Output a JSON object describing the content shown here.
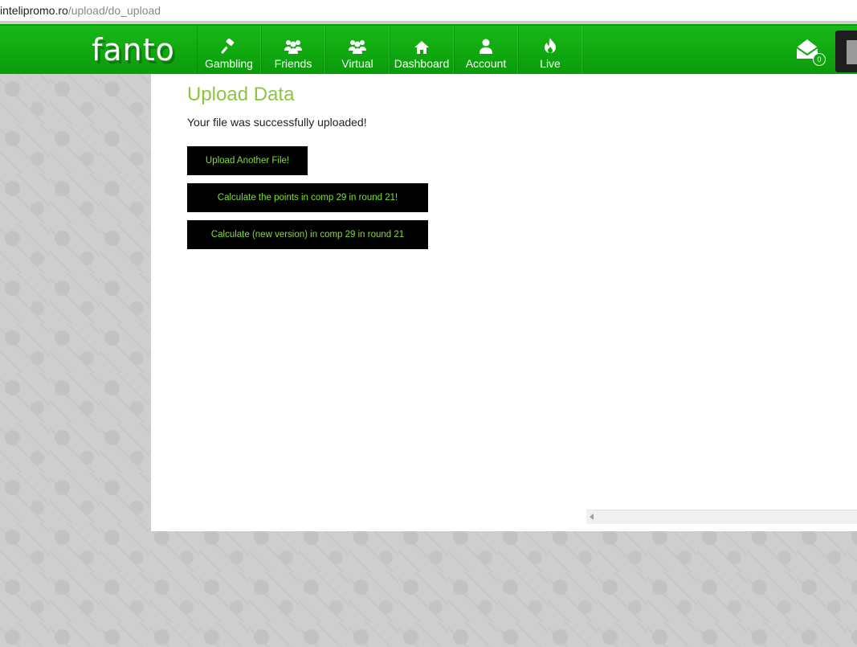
{
  "browser": {
    "url_domain": "intelipromo.ro",
    "url_path": "/upload/do_upload"
  },
  "header": {
    "logo": "fanto",
    "nav": [
      {
        "label": "Gambling",
        "icon": "gavel-icon"
      },
      {
        "label": "Friends",
        "icon": "users-icon"
      },
      {
        "label": "Virtual",
        "icon": "users-icon"
      },
      {
        "label": "Dashboard",
        "icon": "home-icon"
      },
      {
        "label": "Account",
        "icon": "user-icon"
      },
      {
        "label": "Live",
        "icon": "fire-icon"
      }
    ],
    "messages_count": "0"
  },
  "main": {
    "title": "Upload Data",
    "message": "Your file was successfully uploaded!",
    "buttons": [
      "Upload Another File!",
      "Calculate the points in comp 29 in round 21!",
      "Calculate (new version) in comp 29 in round 21"
    ]
  },
  "colors": {
    "brand_green": "#0ea90e",
    "title_green": "#8cc63e",
    "button_text": "#7fe02c"
  }
}
